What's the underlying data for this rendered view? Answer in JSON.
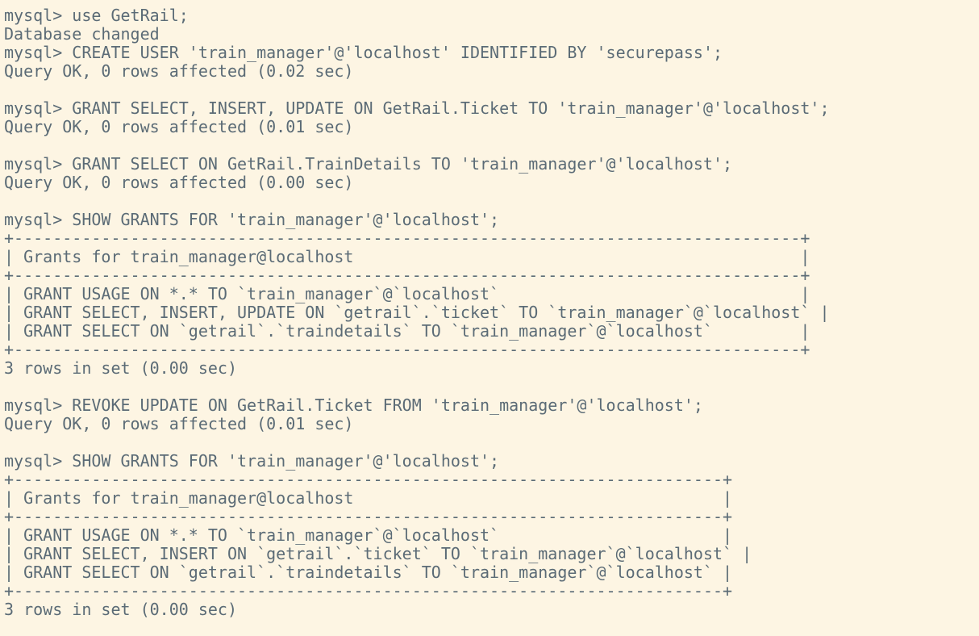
{
  "terminal": {
    "lines": [
      "mysql> use GetRail;",
      "Database changed",
      "mysql> CREATE USER 'train_manager'@'localhost' IDENTIFIED BY 'securepass';",
      "Query OK, 0 rows affected (0.02 sec)",
      "",
      "mysql> GRANT SELECT, INSERT, UPDATE ON GetRail.Ticket TO 'train_manager'@'localhost';",
      "Query OK, 0 rows affected (0.01 sec)",
      "",
      "mysql> GRANT SELECT ON GetRail.TrainDetails TO 'train_manager'@'localhost';",
      "Query OK, 0 rows affected (0.00 sec)",
      "",
      "mysql> SHOW GRANTS FOR 'train_manager'@'localhost';",
      "+---------------------------------------------------------------------------------+",
      "| Grants for train_manager@localhost                                              |",
      "+---------------------------------------------------------------------------------+",
      "| GRANT USAGE ON *.* TO `train_manager`@`localhost`                               |",
      "| GRANT SELECT, INSERT, UPDATE ON `getrail`.`ticket` TO `train_manager`@`localhost` |",
      "| GRANT SELECT ON `getrail`.`traindetails` TO `train_manager`@`localhost`         |",
      "+---------------------------------------------------------------------------------+",
      "3 rows in set (0.00 sec)",
      "",
      "mysql> REVOKE UPDATE ON GetRail.Ticket FROM 'train_manager'@'localhost';",
      "Query OK, 0 rows affected (0.01 sec)",
      "",
      "mysql> SHOW GRANTS FOR 'train_manager'@'localhost';",
      "+-------------------------------------------------------------------------+",
      "| Grants for train_manager@localhost                                      |",
      "+-------------------------------------------------------------------------+",
      "| GRANT USAGE ON *.* TO `train_manager`@`localhost`                       |",
      "| GRANT SELECT, INSERT ON `getrail`.`ticket` TO `train_manager`@`localhost` |",
      "| GRANT SELECT ON `getrail`.`traindetails` TO `train_manager`@`localhost` |",
      "+-------------------------------------------------------------------------+",
      "3 rows in set (0.00 sec)"
    ]
  }
}
